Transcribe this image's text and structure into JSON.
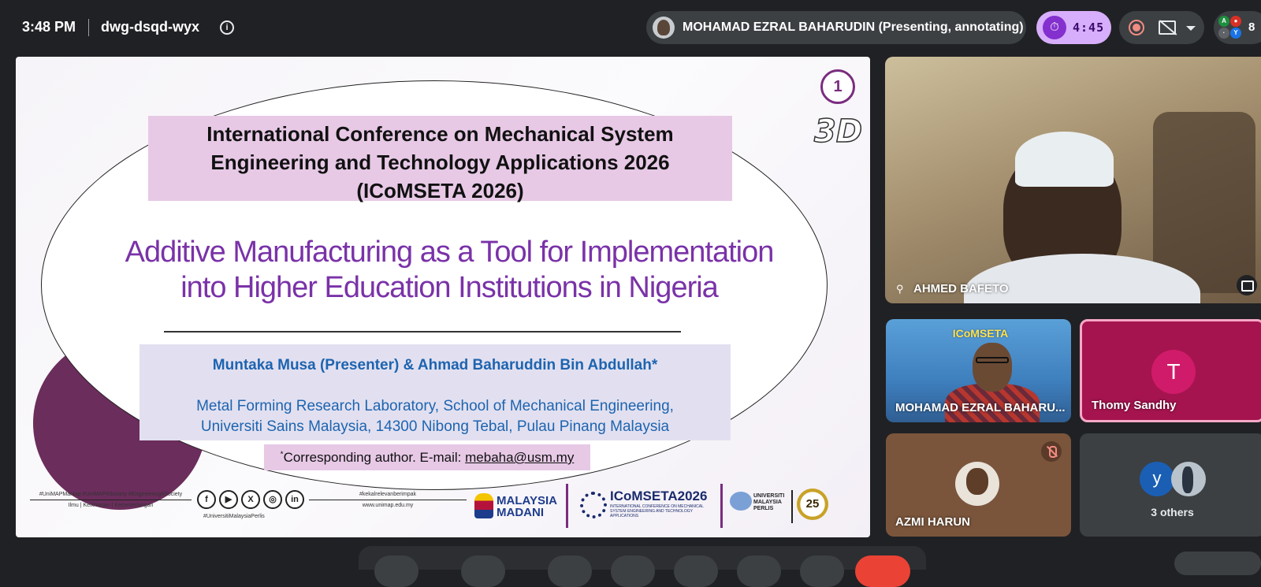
{
  "meeting": {
    "time": "3:48 PM",
    "code": "dwg-dsqd-wyx",
    "presenter": "MOHAMAD EZRAL BAHARUDIN (Presenting, annotating)",
    "timer": "4:45",
    "participant_count": "8"
  },
  "slide": {
    "number": "1",
    "logo_3d": "3D",
    "conference_lines": [
      "International Conference on Mechanical System",
      "Engineering and Technology Applications 2026",
      "(ICoMSETA 2026)"
    ],
    "title_lines": [
      "Additive Manufacturing as a Tool for Implementation",
      "into Higher Education Institutions in Nigeria"
    ],
    "authors": "Muntaka Musa (Presenter) & Ahmad Baharuddin Bin Abdullah*",
    "affiliation_lines": [
      "Metal Forming Research Laboratory, School of Mechanical Engineering,",
      "Universiti Sains Malaysia, 14300 Nibong Tebal, Pulau Pinang Malaysia"
    ],
    "corresponding_prefix": "*",
    "corresponding_label": "Corresponding author. E-mail: ",
    "corresponding_email": "mebaha@usm.my",
    "footer": {
      "tags": "#UniMAPMantap #UniMAP4Society #Engineering4Society",
      "motto": "Ilmu | Keikhlasan | Kecemerlangan",
      "hashtag": "#UniversitiMalaysiaPerlis",
      "slogan": "#kekalrelevanberimpak",
      "website": "www.unimap.edu.my",
      "madani_line1": "MALAYSIA",
      "madani_line2": "MADANI",
      "icomseta_title": "ICoMSETA2026",
      "icomseta_sub": "INTERNATIONAL CONFERENCE ON MECHANICAL SYSTEM ENGINEERING AND TECHNOLOGY APPLICATIONS",
      "unimap_line1": "UNIVERSITI",
      "unimap_line2": "MALAYSIA",
      "unimap_line3": "PERLIS",
      "badge": "25"
    },
    "social_icons": [
      "f",
      "▶",
      "X",
      "◎",
      "in"
    ]
  },
  "tiles": {
    "main_name": "AHMED BAFETO",
    "ezral_name": "MOHAMAD EZRAL BAHARU...",
    "ezral_banner": "ICoMSETA",
    "thomy_initial": "T",
    "thomy_name": "Thomy Sandhy",
    "azmi_name": "AZMI HARUN",
    "others_initial": "y",
    "others_label": "3 others"
  },
  "colors": {
    "accent_purple": "#7a32a8",
    "timer_bg": "#d7aefb",
    "thomy_bg": "#a5144f",
    "link_blue": "#1d64b0"
  }
}
